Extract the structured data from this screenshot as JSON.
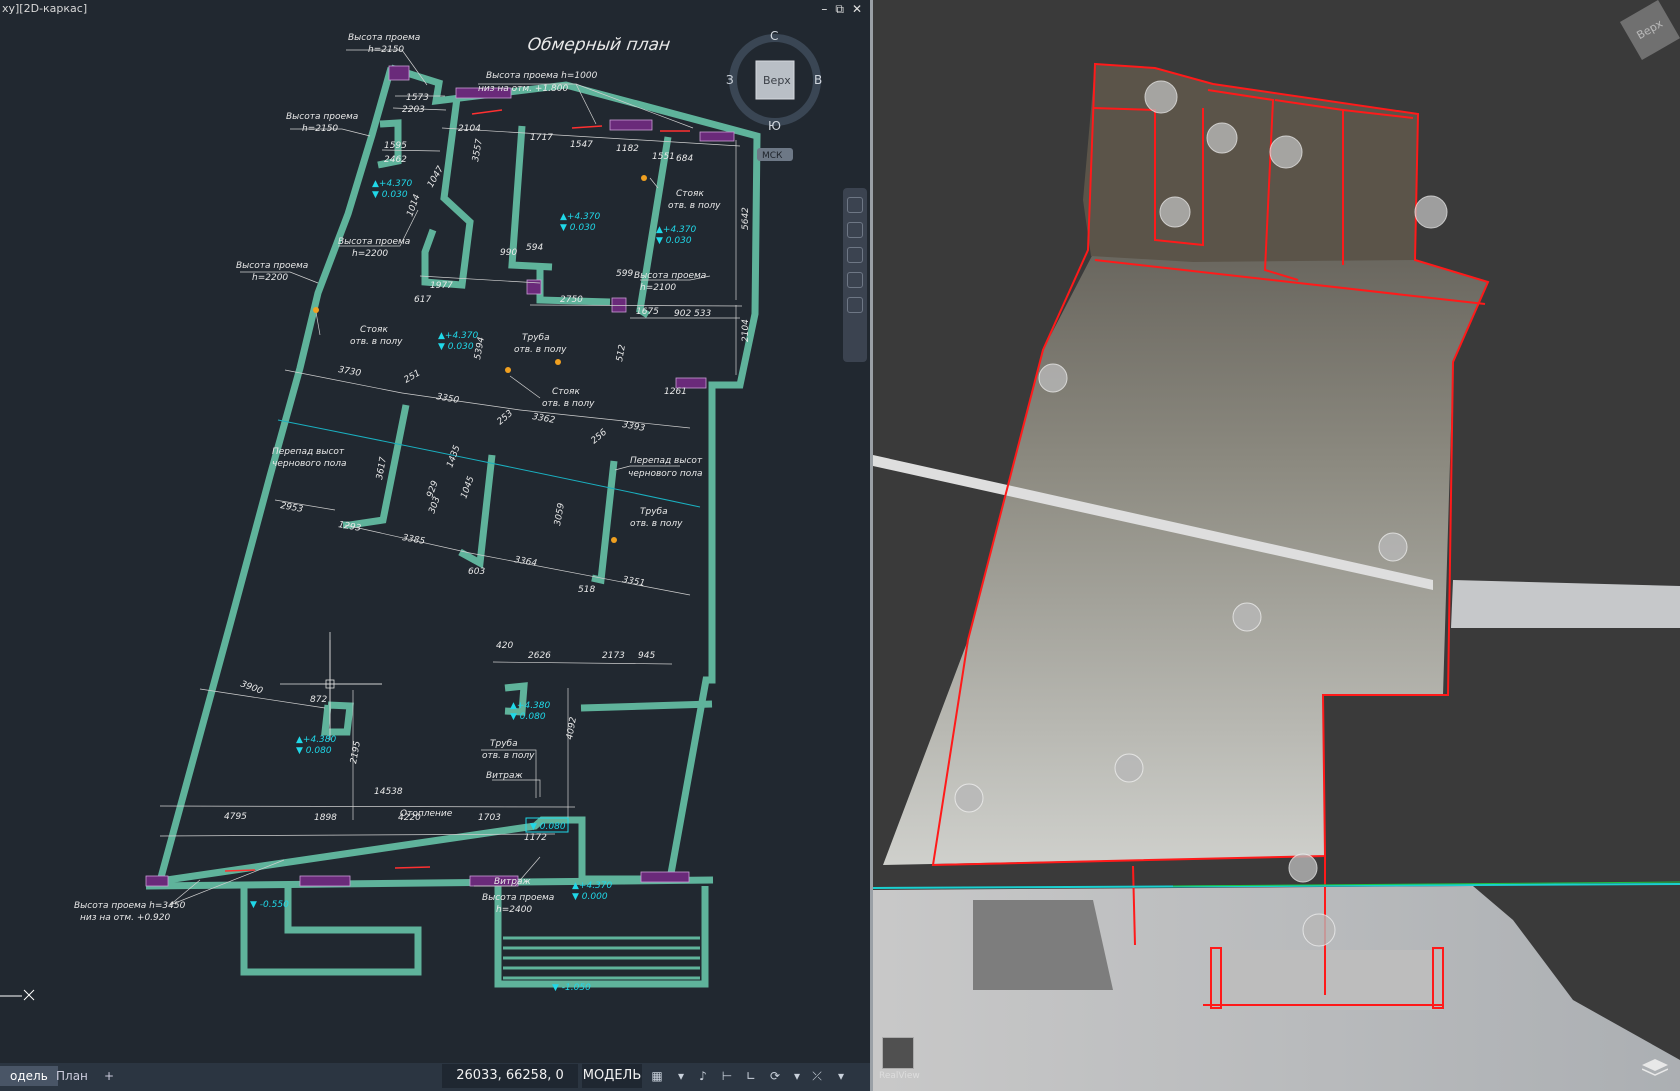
{
  "cad": {
    "title": "xy][2D-каркас]",
    "window_buttons": [
      "–",
      "⧉",
      "✕"
    ],
    "plan_title": "Обмерный план",
    "viewcube": {
      "top": "Верх",
      "north": "С",
      "south": "Ю",
      "west": "З",
      "east": "В",
      "wcs": "МСК"
    },
    "dims": [
      "1573",
      "2203",
      "2104",
      "1717",
      "1547",
      "1182",
      "1551",
      "684",
      "1595",
      "2462",
      "1047",
      "3557",
      "1014",
      "990",
      "594",
      "1977",
      "617",
      "2750",
      "599",
      "1675",
      "902",
      "533",
      "5642",
      "2104",
      "3730",
      "251",
      "3350",
      "3362",
      "3393",
      "253",
      "256",
      "3617",
      "3059",
      "2953",
      "1293",
      "3385",
      "3364",
      "603",
      "518",
      "3351",
      "420",
      "2626",
      "2173",
      "945",
      "3900",
      "872",
      "4092",
      "2195",
      "14538",
      "4795",
      "1898",
      "4220",
      "1703",
      "1172",
      "1261",
      "512",
      "5394",
      "1435",
      "929",
      "1045",
      "303"
    ],
    "labels": {
      "vp1": "Высота проема",
      "vp1b": "h=2150",
      "vp2": "Высота проема h=1000",
      "vp2b": "низ на отм. +1.800",
      "vp3": "Высота проема",
      "vp3b": "h=2150",
      "vp4": "Высота проема",
      "vp4b": "h=2200",
      "vp5": "Высота проема",
      "vp5b": "h=2200",
      "vp6": "Высота проема",
      "vp6b": "h=2100",
      "st1": "Стояк",
      "st1b": "отв. в полу",
      "st2": "Стояк",
      "st2b": "отв. в полу",
      "st3": "Стояк",
      "st3b": "отв. в полу",
      "tr1": "Труба",
      "tr1b": "отв. в полу",
      "tr2": "Труба",
      "tr2b": "отв. в полу",
      "tr3": "Труба",
      "tr3b": "отв. в полу",
      "pv1": "Перепад высот",
      "pv1b": "чернового пола",
      "pv2": "Перепад высот",
      "pv2b": "чернового пола",
      "vitr1": "Витраж",
      "vitr2": "Витраж",
      "otop": "Отопление",
      "vp7": "Высота проема h=3450",
      "vp7b": "низ на отм. +0.920",
      "vp8": "Высота проема",
      "vp8b": "h=2400"
    },
    "elevations": {
      "e1a": "▲+4.370",
      "e1b": "▼ 0.030",
      "e2a": "▲+4.370",
      "e2b": "▼ 0.030",
      "e3a": "▲+4.370",
      "e3b": "▼ 0.030",
      "e4a": "▲+4.370",
      "e4b": "▼ 0.030",
      "e5a": "▲+4.380",
      "e5b": "▼ 0.080",
      "e6a": "▲+4.380",
      "e6b": "▼ 0.080",
      "e7": "▼ 0.080",
      "e8": "▼ -0.550",
      "e9a": "▲+4.370",
      "e9b": "▼ 0.000",
      "e10": "▼ -1.050"
    },
    "status": {
      "tab_model": "одель",
      "tab_plan": "План",
      "tab_add": "+",
      "coords": "26033, 66258, 0",
      "model": "МОДЕЛЬ",
      "icons": [
        "grid-icon",
        "snap-icon",
        "ortho-icon",
        "polar-icon",
        "osnap-icon",
        "otrack-icon"
      ]
    }
  },
  "pointcloud": {
    "viewcube_label": "Верх",
    "realview_label": "RealView"
  },
  "colors": {
    "cad_bg": "#212830",
    "wall": "#5fb39b",
    "hatch": "#6a2a7a",
    "dim": "#e8e8e8",
    "elev": "#20d8e8",
    "pc_bg": "#3a3a3a",
    "pc_outline": "#ff1a1a"
  }
}
